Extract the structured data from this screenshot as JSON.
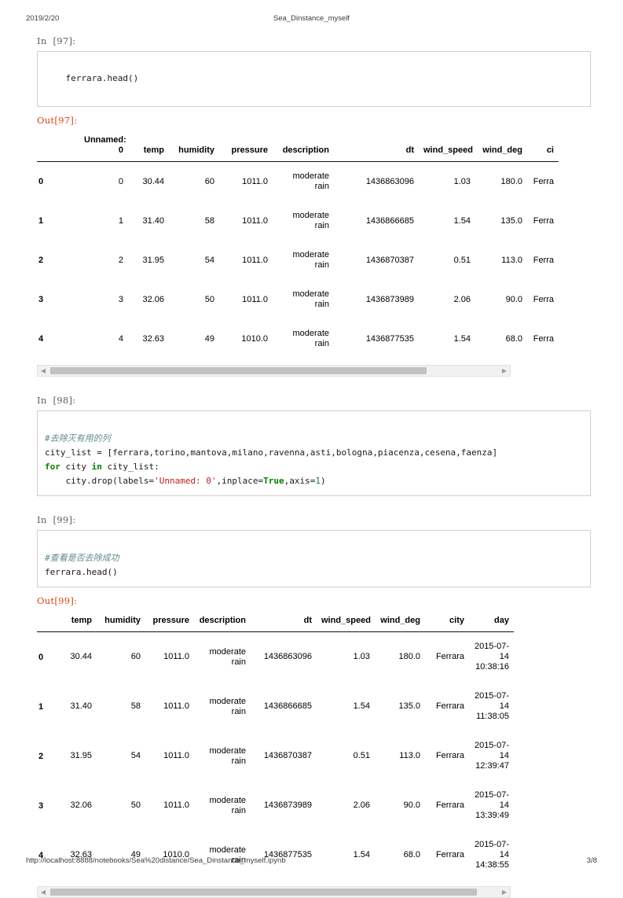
{
  "print_header": {
    "date": "2019/2/20",
    "title": "Sea_Dinstance_myself"
  },
  "print_footer": {
    "url": "http://localhost:8888/notebooks/Sea%20distance/Sea_Dinstance_myself.ipynb",
    "page": "3/8"
  },
  "cells": {
    "cell97": {
      "in_prompt": "In  [97]:",
      "out_prompt": "Out[97]:",
      "code": "ferrara.head()"
    },
    "cell98": {
      "in_prompt": "In  [98]:",
      "comment": "#去除灭有用的列",
      "line2_a": "city_list = [ferrara,torino,mantova,milano,ravenna,asti,bologna,piacenza,cesena,faenza]",
      "line3_for": "for",
      "line3_mid": " city ",
      "line3_in": "in",
      "line3_end": " city_list:",
      "line4_a": "    city.drop(labels=",
      "line4_str": "'Unnamed: 0'",
      "line4_b": ",inplace=",
      "line4_true": "True",
      "line4_c": ",axis=",
      "line4_num": "1",
      "line4_d": ")"
    },
    "cell99": {
      "in_prompt": "In  [99]:",
      "out_prompt": "Out[99]:",
      "comment": "#查看是否去除成功",
      "code": "ferrara.head()"
    }
  },
  "table1": {
    "columns": [
      "Unnamed: 0",
      "temp",
      "humidity",
      "pressure",
      "description",
      "dt",
      "wind_speed",
      "wind_deg",
      "ci"
    ],
    "index": [
      "0",
      "1",
      "2",
      "3",
      "4"
    ],
    "rows": [
      [
        "0",
        "30.44",
        "60",
        "1011.0",
        "moderate rain",
        "1436863096",
        "1.03",
        "180.0",
        "Ferra"
      ],
      [
        "1",
        "31.40",
        "58",
        "1011.0",
        "moderate rain",
        "1436866685",
        "1.54",
        "135.0",
        "Ferra"
      ],
      [
        "2",
        "31.95",
        "54",
        "1011.0",
        "moderate rain",
        "1436870387",
        "0.51",
        "113.0",
        "Ferra"
      ],
      [
        "3",
        "32.06",
        "50",
        "1011.0",
        "moderate rain",
        "1436873989",
        "2.06",
        "90.0",
        "Ferra"
      ],
      [
        "4",
        "32.63",
        "49",
        "1010.0",
        "moderate rain",
        "1436877535",
        "1.54",
        "68.0",
        "Ferra"
      ]
    ],
    "scrollbar": {
      "left_arrow": "◀",
      "right_arrow": "▶",
      "thumb_percent": 81
    }
  },
  "table2": {
    "columns": [
      "temp",
      "humidity",
      "pressure",
      "description",
      "dt",
      "wind_speed",
      "wind_deg",
      "city",
      "day"
    ],
    "index": [
      "0",
      "1",
      "2",
      "3",
      "4"
    ],
    "rows": [
      [
        "30.44",
        "60",
        "1011.0",
        "moderate rain",
        "1436863096",
        "1.03",
        "180.0",
        "Ferrara",
        "2015-07-14 10:38:16"
      ],
      [
        "31.40",
        "58",
        "1011.0",
        "moderate rain",
        "1436866685",
        "1.54",
        "135.0",
        "Ferrara",
        "2015-07-14 11:38:05"
      ],
      [
        "31.95",
        "54",
        "1011.0",
        "moderate rain",
        "1436870387",
        "0.51",
        "113.0",
        "Ferrara",
        "2015-07-14 12:39:47"
      ],
      [
        "32.06",
        "50",
        "1011.0",
        "moderate rain",
        "1436873989",
        "2.06",
        "90.0",
        "Ferrara",
        "2015-07-14 13:39:49"
      ],
      [
        "32.63",
        "49",
        "1010.0",
        "moderate rain",
        "1436877535",
        "1.54",
        "68.0",
        "Ferrara",
        "2015-07-14 14:38:55"
      ]
    ],
    "scrollbar": {
      "left_arrow": "◀",
      "right_arrow": "▶",
      "thumb_percent": 92
    }
  },
  "colors": {
    "out_prompt": "#d84315",
    "in_prompt": "#55606b",
    "comment": "#5f8a8b",
    "string": "#ba2121",
    "keyword": "#008000",
    "cell_border": "#cfcfcf",
    "scroll_thumb": "#c1c1c1"
  }
}
